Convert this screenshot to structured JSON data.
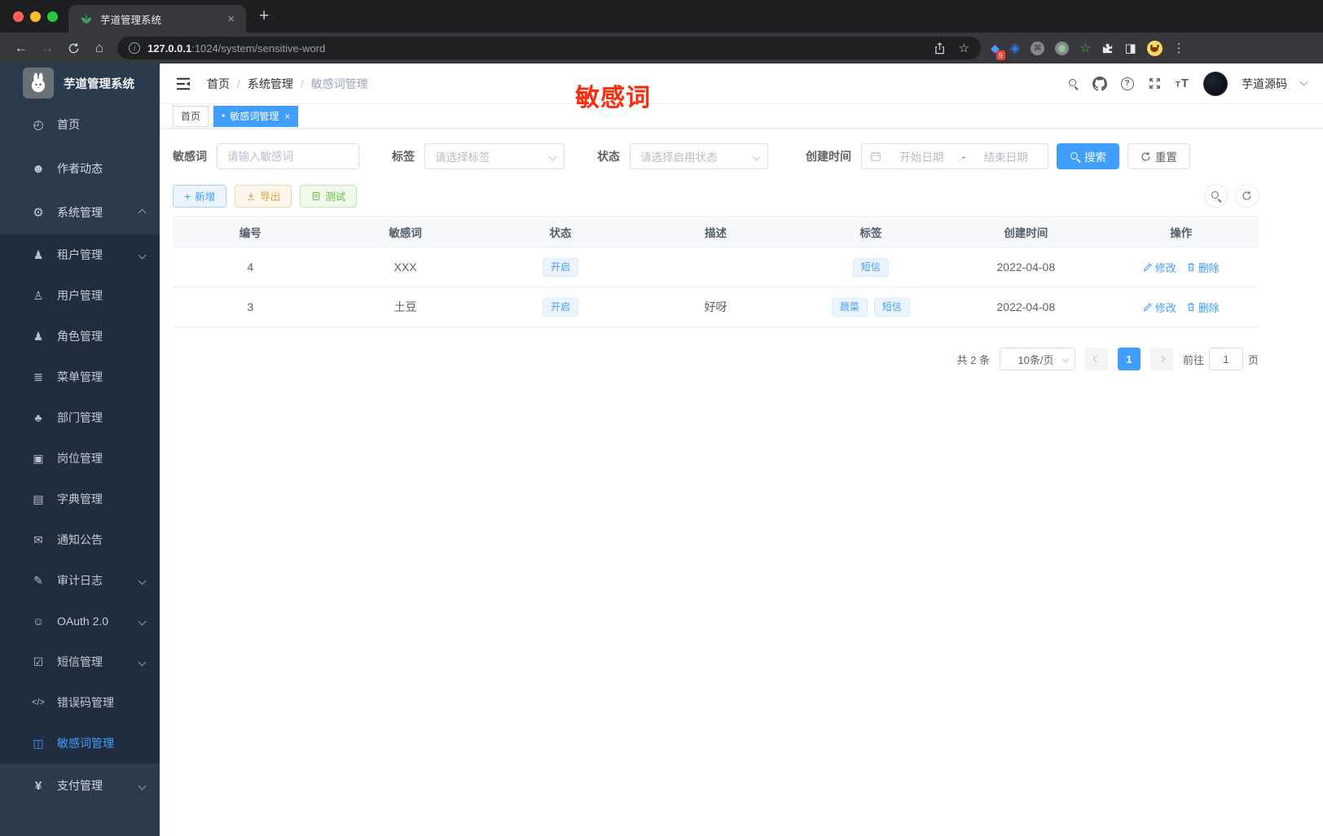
{
  "colors": {
    "accent": "#409eff",
    "watermark_red": "#fd2b0d",
    "success": "#67c23a",
    "warning": "#e6a23c",
    "sidebar_bg": "#2c3a4d",
    "submenu_bg": "#202d3e"
  },
  "browser": {
    "tab_title": "芋道管理系统",
    "close_glyph": "×",
    "new_tab_glyph": "+",
    "url_host": "127.0.0.1",
    "url_path": ":1024/system/sensitive-word",
    "extension_badge": "9",
    "back_glyph": "←",
    "forward_glyph": "→",
    "home_glyph": "⌂",
    "star_glyph": "☆",
    "cmd_glyph": "⌘",
    "green_star_glyph": "☆",
    "panel_glyph": "◨",
    "diamond_glyph": "◆",
    "gem_glyph": "◈",
    "menu_glyph": "⋮"
  },
  "sidebar": {
    "title": "芋道管理系统",
    "menu": [
      {
        "glyph": "◴",
        "label": "首页"
      },
      {
        "glyph": "☻",
        "label": "作者动态"
      },
      {
        "glyph": "⚙",
        "label": "系统管理"
      }
    ],
    "submenu": [
      {
        "glyph": "♟",
        "label": "租户管理"
      },
      {
        "glyph": "♙",
        "label": "用户管理"
      },
      {
        "glyph": "♟",
        "label": "角色管理"
      },
      {
        "glyph": "≣",
        "label": "菜单管理"
      },
      {
        "glyph": "♣",
        "label": "部门管理"
      },
      {
        "glyph": "▣",
        "label": "岗位管理"
      },
      {
        "glyph": "▤",
        "label": "字典管理"
      },
      {
        "glyph": "✉",
        "label": "通知公告"
      },
      {
        "glyph": "✎",
        "label": "审计日志"
      },
      {
        "glyph": "☺",
        "label": "OAuth 2.0"
      },
      {
        "glyph": "☑",
        "label": "短信管理"
      },
      {
        "glyph": "</>",
        "label": "错误码管理"
      },
      {
        "glyph": "◫",
        "label": "敏感词管理"
      }
    ],
    "payment": {
      "glyph": "¥",
      "label": "支付管理"
    }
  },
  "header": {
    "breadcrumb": [
      "首页",
      "系统管理",
      "敏感词管理"
    ],
    "separator": "/",
    "watermark": "敏感词",
    "username": "芋道源码",
    "fontsize_small": "T",
    "fontsize_big": "T",
    "help_glyph": "?"
  },
  "tabs": {
    "home": "首页",
    "active": "敏感词管理",
    "dot": "●",
    "close": "×"
  },
  "filters": {
    "word": {
      "label": "敏感词",
      "placeholder": "请输入敏感词"
    },
    "tag": {
      "label": "标签",
      "placeholder": "请选择标签"
    },
    "status": {
      "label": "状态",
      "placeholder": "请选择启用状态"
    },
    "created": {
      "label": "创建时间",
      "start_placeholder": "开始日期",
      "separator": "-",
      "end_placeholder": "结束日期"
    },
    "search_label": "搜索",
    "reset_label": "重置"
  },
  "toolbar": {
    "add_label": "新增",
    "add_glyph": "+",
    "export_label": "导出",
    "test_label": "测试"
  },
  "table": {
    "columns": [
      "编号",
      "敏感词",
      "状态",
      "描述",
      "标签",
      "创建时间",
      "操作"
    ],
    "rows": [
      {
        "id": "4",
        "word": "XXX",
        "status": "开启",
        "desc": "",
        "tags": [
          "短信"
        ],
        "created": "2022-04-08"
      },
      {
        "id": "3",
        "word": "土豆",
        "status": "开启",
        "desc": "好呀",
        "tags": [
          "蔬菜",
          "短信"
        ],
        "created": "2022-04-08"
      }
    ],
    "ops": {
      "edit": "修改",
      "delete": "删除"
    }
  },
  "pagination": {
    "total": "共 2 条",
    "page_size": "10条/页",
    "current_page": "1",
    "goto_label": "前往",
    "goto_value": "1",
    "page_unit": "页"
  }
}
